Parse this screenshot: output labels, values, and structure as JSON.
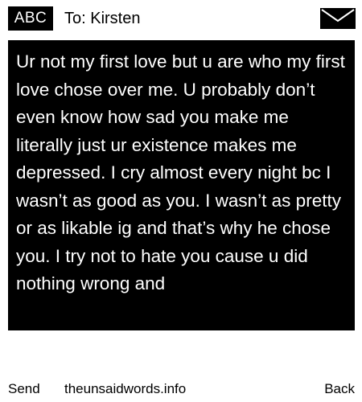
{
  "header": {
    "badge_label": "ABC",
    "recipient_label": "To: Kirsten",
    "envelope_icon": "envelope-icon"
  },
  "message": {
    "text": "Ur not my first love but u are who my first love chose over me. U probably don’t even know how sad you make me literally just ur existence makes me depressed. I cry almost every night bc I wasn’t as good as you. I wasn’t as pretty or as likable ig and that’s why he chose you. I try not to hate you cause u did nothing wrong and"
  },
  "footer": {
    "send_label": "Send",
    "site_label": "theunsaidwords.info",
    "back_label": "Back"
  },
  "colors": {
    "background": "#ffffff",
    "panel": "#000000",
    "panel_text": "#ffffff"
  }
}
